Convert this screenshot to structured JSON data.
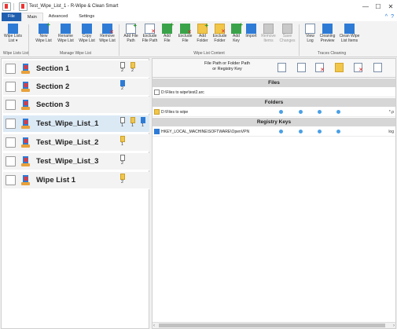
{
  "window": {
    "title": "Test_Wipe_List_1 - R-Wipe & Clean Smart",
    "controls": [
      "—",
      "☐",
      "✕"
    ]
  },
  "menu": {
    "tabs": [
      "File",
      "Main",
      "Advanced",
      "Settings"
    ],
    "right_icons": [
      "^",
      "?"
    ]
  },
  "ribbon": {
    "buttons": [
      {
        "label": "Wipe Lists\nList ▾",
        "icon": "wipe-lists-icon"
      },
      {
        "label": "New\nWipe List",
        "icon": "new-wipe-list-icon"
      },
      {
        "label": "Rename\nWipe List",
        "icon": "rename-wipe-list-icon"
      },
      {
        "label": "Copy\nWipe List",
        "icon": "copy-wipe-list-icon"
      },
      {
        "label": "Remove\nWipe List",
        "icon": "remove-wipe-list-icon"
      },
      {
        "label": "Add File\nPath",
        "icon": "add-file-path-icon"
      },
      {
        "label": "Exclude\nFile Path",
        "icon": "exclude-file-path-icon"
      },
      {
        "label": "Add\nFile",
        "icon": "add-file-icon"
      },
      {
        "label": "Exclude\nFile",
        "icon": "exclude-file-icon"
      },
      {
        "label": "Add\nFolder",
        "icon": "add-folder-icon"
      },
      {
        "label": "Exclude\nFolder",
        "icon": "exclude-folder-icon"
      },
      {
        "label": "Add\nKey",
        "icon": "add-key-icon"
      },
      {
        "label": "Import",
        "icon": "import-icon"
      },
      {
        "label": "Remove\nItems",
        "icon": "remove-items-icon"
      },
      {
        "label": "Save\nChanges",
        "icon": "save-changes-icon"
      },
      {
        "label": "View\nLog",
        "icon": "view-log-icon"
      },
      {
        "label": "Cleaning\nPreview",
        "icon": "cleaning-preview-icon"
      },
      {
        "label": "Clean Wipe\nList Items",
        "icon": "clean-wipe-list-items-icon"
      }
    ],
    "groups": [
      "Wipe Lists List",
      "Manage Wipe List",
      "Wipe List Content",
      "Traces Cleaning"
    ]
  },
  "left_list": {
    "items": [
      {
        "name": "Section 1",
        "stats": [
          {
            "type": "doc",
            "count": "2"
          },
          {
            "type": "folder",
            "count": "2"
          }
        ]
      },
      {
        "name": "Section 2",
        "stats": [
          {
            "type": "reg",
            "count": "2"
          }
        ]
      },
      {
        "name": "Section 3",
        "stats": []
      },
      {
        "name": "Test_Wipe_List_1",
        "stats": [
          {
            "type": "doc",
            "count": "1"
          },
          {
            "type": "folder",
            "count": "1"
          },
          {
            "type": "reg",
            "count": "1"
          }
        ],
        "selected": true
      },
      {
        "name": "Test_Wipe_List_2",
        "stats": [
          {
            "type": "folder",
            "count": "1"
          }
        ]
      },
      {
        "name": "Test_Wipe_List_3",
        "stats": [
          {
            "type": "doc",
            "count": "2"
          }
        ]
      },
      {
        "name": "Wipe List 1",
        "stats": [
          {
            "type": "folder",
            "count": "2"
          }
        ]
      }
    ]
  },
  "content": {
    "column_title": "File Path or Folder Path\nor Registry Key",
    "sections": {
      "files": "Files",
      "folders": "Folders",
      "registry": "Registry Keys"
    },
    "file_row": {
      "path": "D:\\Files to wipe\\test2.arc"
    },
    "folder_row": {
      "path": "D:\\Files to wipe",
      "tail": "*.p"
    },
    "registry_row": {
      "path": "HKEY_LOCAL_MACHINE\\SOFTWARE\\OpenVPN",
      "tail": "log"
    }
  },
  "colors": {
    "file_tab": "#1f5fb0",
    "selected_row": "#dbe9f5",
    "section_header": "#d6d6d6",
    "dot": "#4aa0e6"
  }
}
